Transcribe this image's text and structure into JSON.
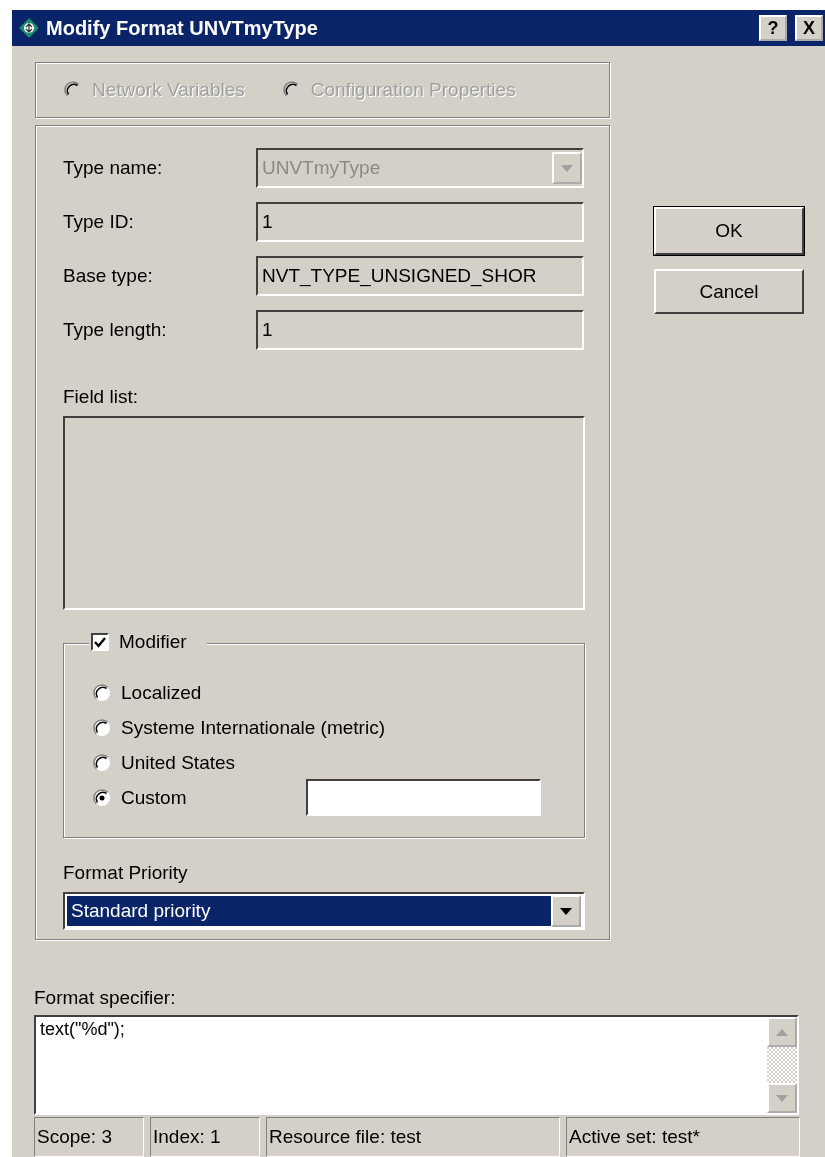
{
  "window": {
    "title": "Modify Format UNVTmyType",
    "controls": [
      "?",
      "X"
    ]
  },
  "scope_options": [
    {
      "label": "Network Variables",
      "selected": false,
      "disabled": true
    },
    {
      "label": "Configuration Properties",
      "selected": false,
      "disabled": true
    }
  ],
  "fields": [
    {
      "label": "Type name:",
      "value": "UNVTmyType",
      "kind": "combo",
      "disabled": true
    },
    {
      "label": "Type ID:",
      "value": "1",
      "kind": "text",
      "disabled": true
    },
    {
      "label": "Base type:",
      "value": "NVT_TYPE_UNSIGNED_SHOR",
      "kind": "text",
      "disabled": true
    },
    {
      "label": "Type length:",
      "value": "1",
      "kind": "text",
      "disabled": true
    }
  ],
  "field_list": {
    "label": "Field list:"
  },
  "modifier": {
    "label": "Modifier",
    "checked": true,
    "options": [
      {
        "label": "Localized",
        "selected": false
      },
      {
        "label": "Systeme Internationale (metric)",
        "selected": false
      },
      {
        "label": "United States",
        "selected": false
      },
      {
        "label": "Custom",
        "selected": true
      }
    ]
  },
  "format_priority": {
    "label": "Format Priority",
    "value": "Standard priority"
  },
  "buttons": [
    {
      "label": "OK",
      "default": true
    },
    {
      "label": "Cancel",
      "default": false
    }
  ],
  "format_specifier": {
    "label": "Format specifier:",
    "value": "text(\"%d\");"
  },
  "status_bar": [
    "Scope: 3",
    "Index: 1",
    "Resource file: test",
    "Active set: test*"
  ]
}
